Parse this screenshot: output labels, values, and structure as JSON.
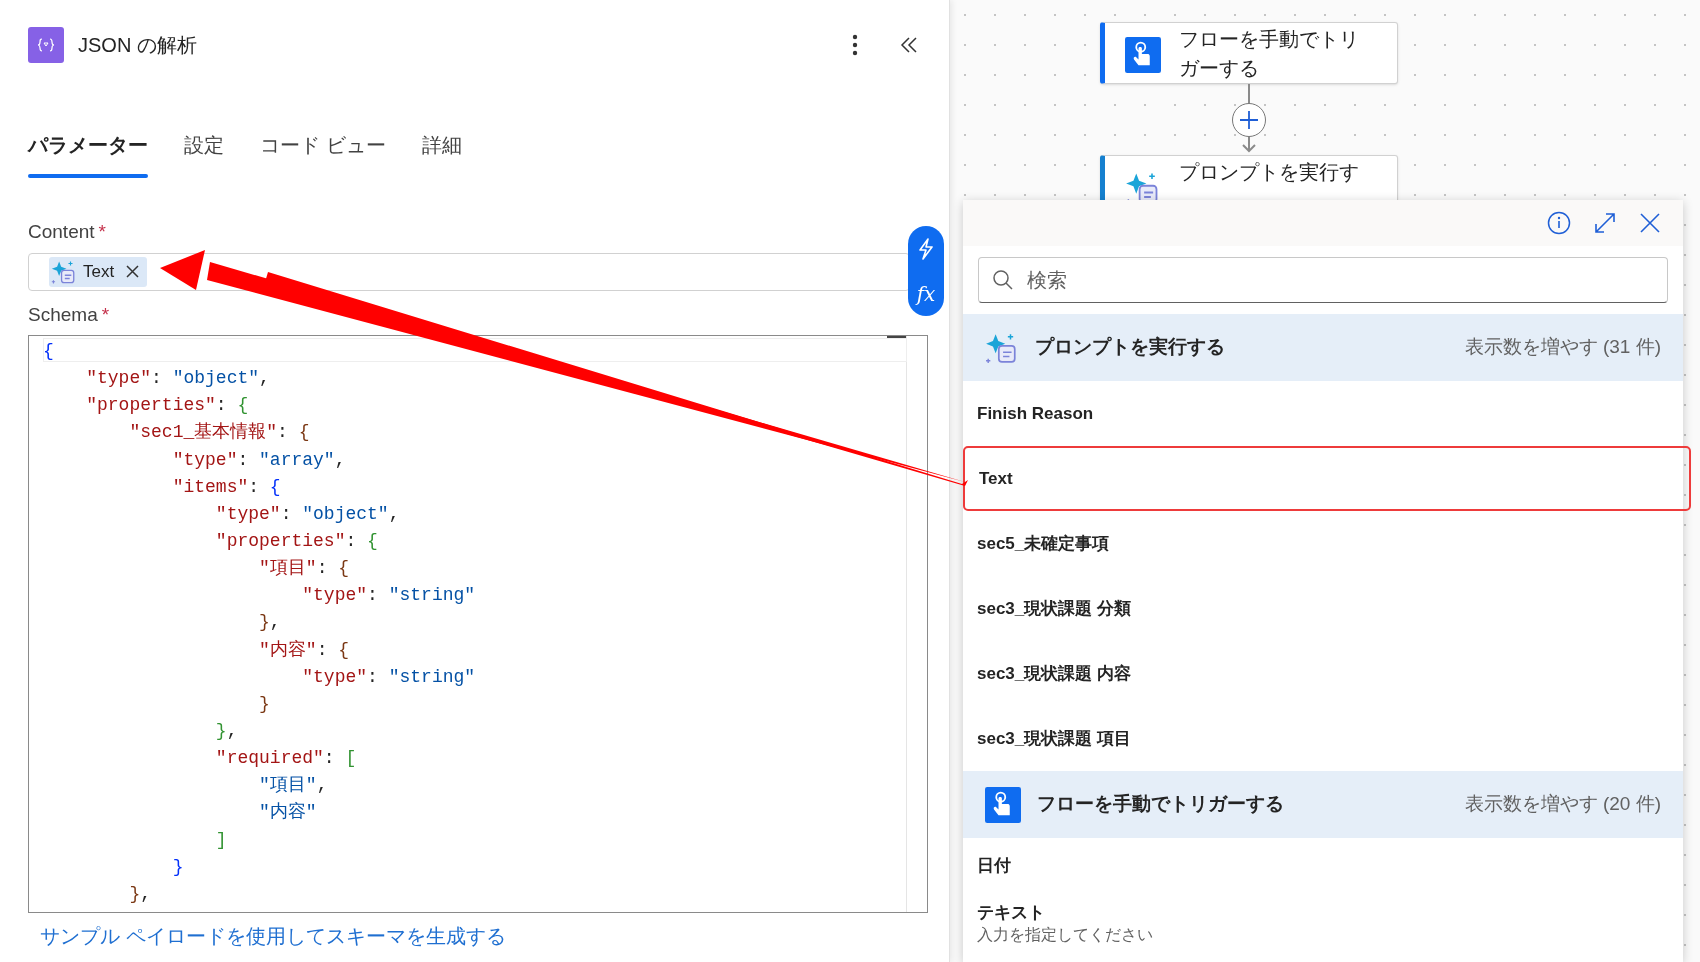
{
  "panel": {
    "title": "JSON の解析",
    "tabs": [
      {
        "label": "パラメーター",
        "selected": true
      },
      {
        "label": "設定",
        "selected": false
      },
      {
        "label": "コード ビュー",
        "selected": false
      },
      {
        "label": "詳細",
        "selected": false
      }
    ],
    "fields": [
      {
        "kind": "token",
        "label": "Content",
        "required_mark": "*",
        "tokens": [
          {
            "label": "Text"
          }
        ]
      },
      {
        "kind": "code",
        "label": "Schema",
        "required_mark": "*",
        "lines": [
          "{",
          "    \"type\": \"object\",",
          "    \"properties\": {",
          "        \"sec1_基本情報\": {",
          "            \"type\": \"array\",",
          "            \"items\": {",
          "                \"type\": \"object\",",
          "                \"properties\": {",
          "                    \"項目\": {",
          "                        \"type\": \"string\"",
          "                    },",
          "                    \"内容\": {",
          "                        \"type\": \"string\"",
          "                    }",
          "                },",
          "                \"required\": [",
          "                    \"項目\",",
          "                    \"内容\"",
          "                ]",
          "            }",
          "        },"
        ]
      }
    ],
    "side_buttons": {
      "expression_label": "fx"
    },
    "link": "サンプル ペイロードを使用してスキーマを生成する"
  },
  "canvas": {
    "nodes": [
      {
        "kind": "trigger",
        "title": "フローを手動でトリガーする"
      },
      {
        "kind": "prompt",
        "title": "プロンプトを実行す"
      }
    ]
  },
  "picker": {
    "search": {
      "placeholder": "検索"
    },
    "groups": [
      {
        "kind": "prompt",
        "title": "プロンプトを実行する",
        "more": "表示数を増やす (31 件)",
        "items": [
          {
            "label": "Finish Reason",
            "highlighted": false
          },
          {
            "label": "Text",
            "highlighted": true
          },
          {
            "label": "sec5_未確定事項",
            "highlighted": false
          },
          {
            "label": "sec3_現状課題 分類",
            "highlighted": false
          },
          {
            "label": "sec3_現状課題 内容",
            "highlighted": false
          },
          {
            "label": "sec3_現状課題 項目",
            "highlighted": false
          }
        ]
      },
      {
        "kind": "trigger",
        "title": "フローを手動でトリガーする",
        "more": "表示数を増やす (20 件)",
        "items": [
          {
            "label": "日付",
            "highlighted": false
          },
          {
            "label": "テキスト",
            "description": "入力を指定してください",
            "highlighted": false
          }
        ]
      }
    ]
  }
}
